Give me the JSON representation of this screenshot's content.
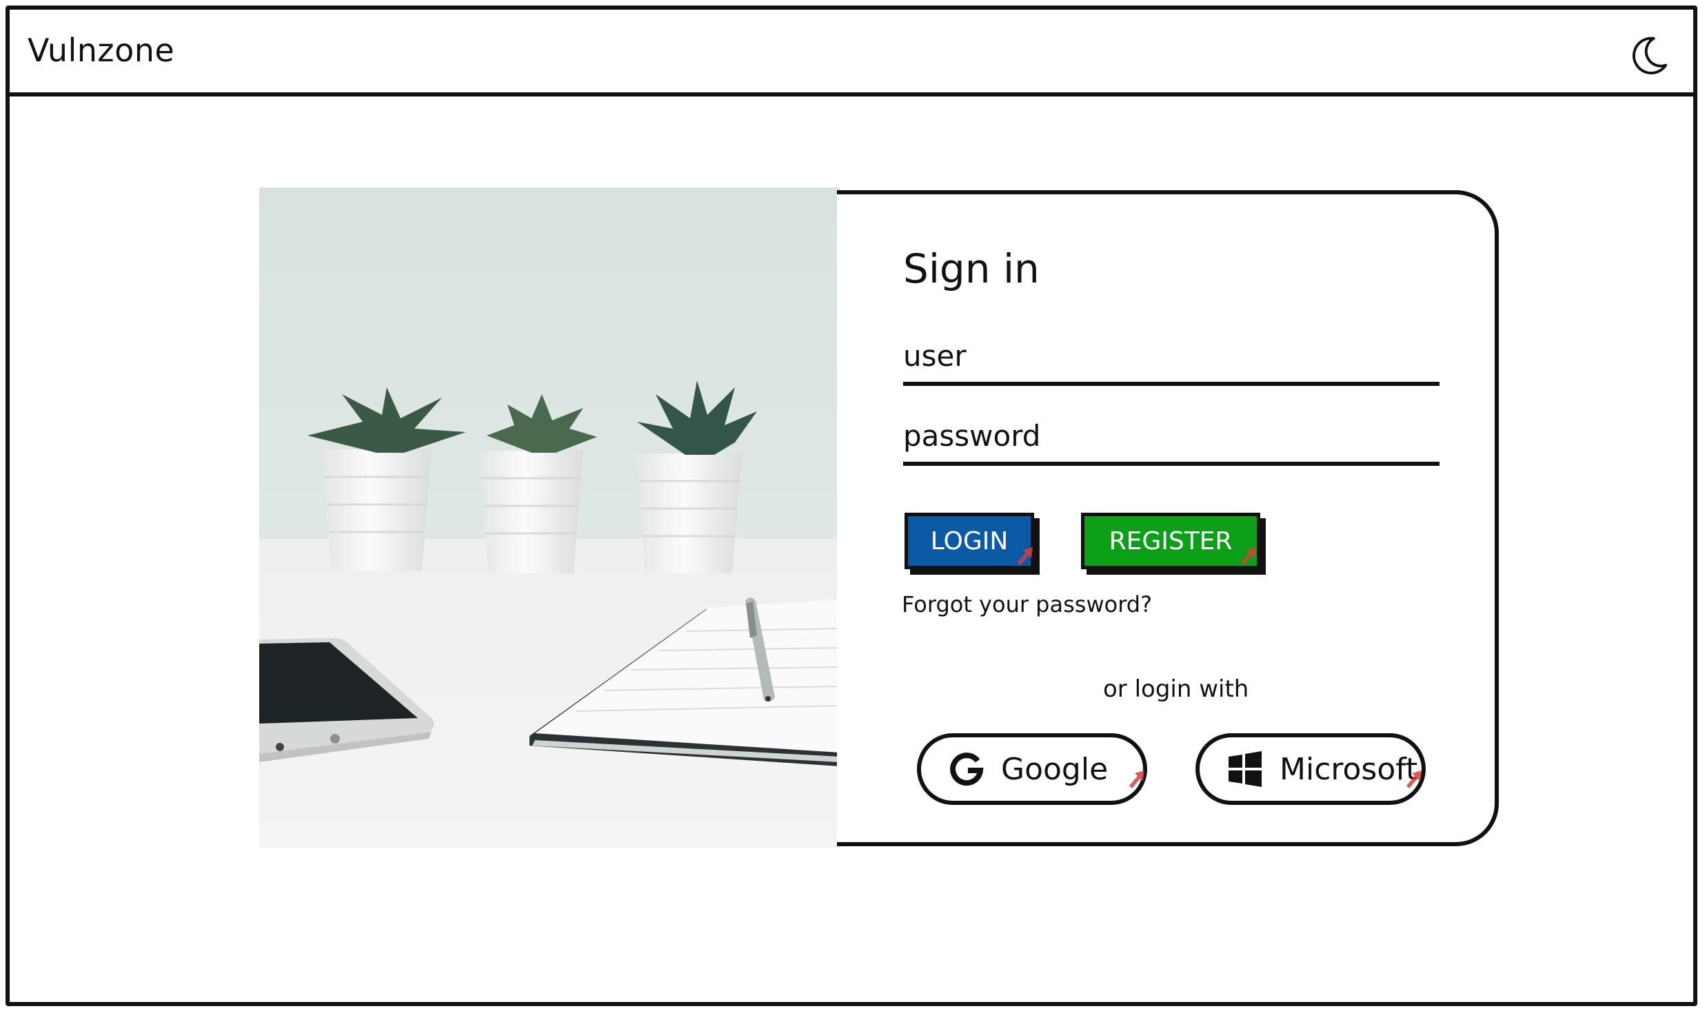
{
  "app": {
    "title": "Vulnzone"
  },
  "icons": {
    "theme_toggle": "moon-icon",
    "google": "google-g-icon",
    "microsoft": "windows-logo-icon"
  },
  "signin": {
    "title": "Sign in",
    "username_placeholder": "user",
    "password_placeholder": "password",
    "login_label": "LOGIN",
    "register_label": "REGISTER",
    "forgot_label": "Forgot your password?",
    "or_label": "or login with",
    "google_label": "Google",
    "microsoft_label": "Microsoft"
  },
  "colors": {
    "login": "#0c5aa6",
    "register": "#0e9f19",
    "border": "#111111",
    "cursor": "#d6403e"
  }
}
